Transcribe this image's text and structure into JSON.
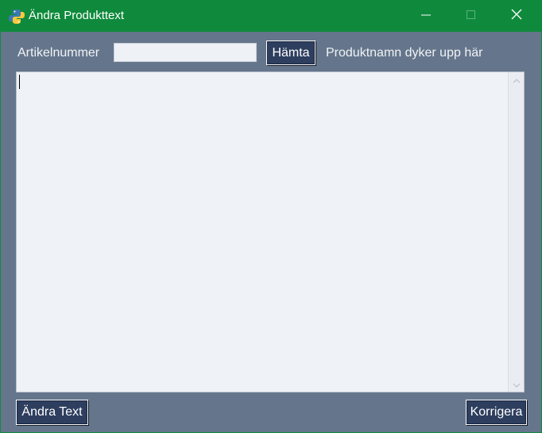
{
  "window": {
    "title": "Ändra Produkttext"
  },
  "form": {
    "article_label": "Artikelnummer",
    "article_value": "",
    "fetch_button": "Hämta",
    "product_name_label": "Produktnamn dyker upp här"
  },
  "editor": {
    "text": ""
  },
  "footer": {
    "edit_text_button": "Ändra Text",
    "correct_button": "Korrigera"
  },
  "icons": {
    "app": "python-icon",
    "minimize": "minimize-icon",
    "maximize": "maximize-icon",
    "close": "close-icon",
    "scroll_up": "chevron-up-icon",
    "scroll_down": "chevron-down-icon"
  },
  "colors": {
    "titlebar": "#0f8a3c",
    "background": "#65768c",
    "button": "#2d3e5e",
    "text_area": "#eff2f7"
  }
}
